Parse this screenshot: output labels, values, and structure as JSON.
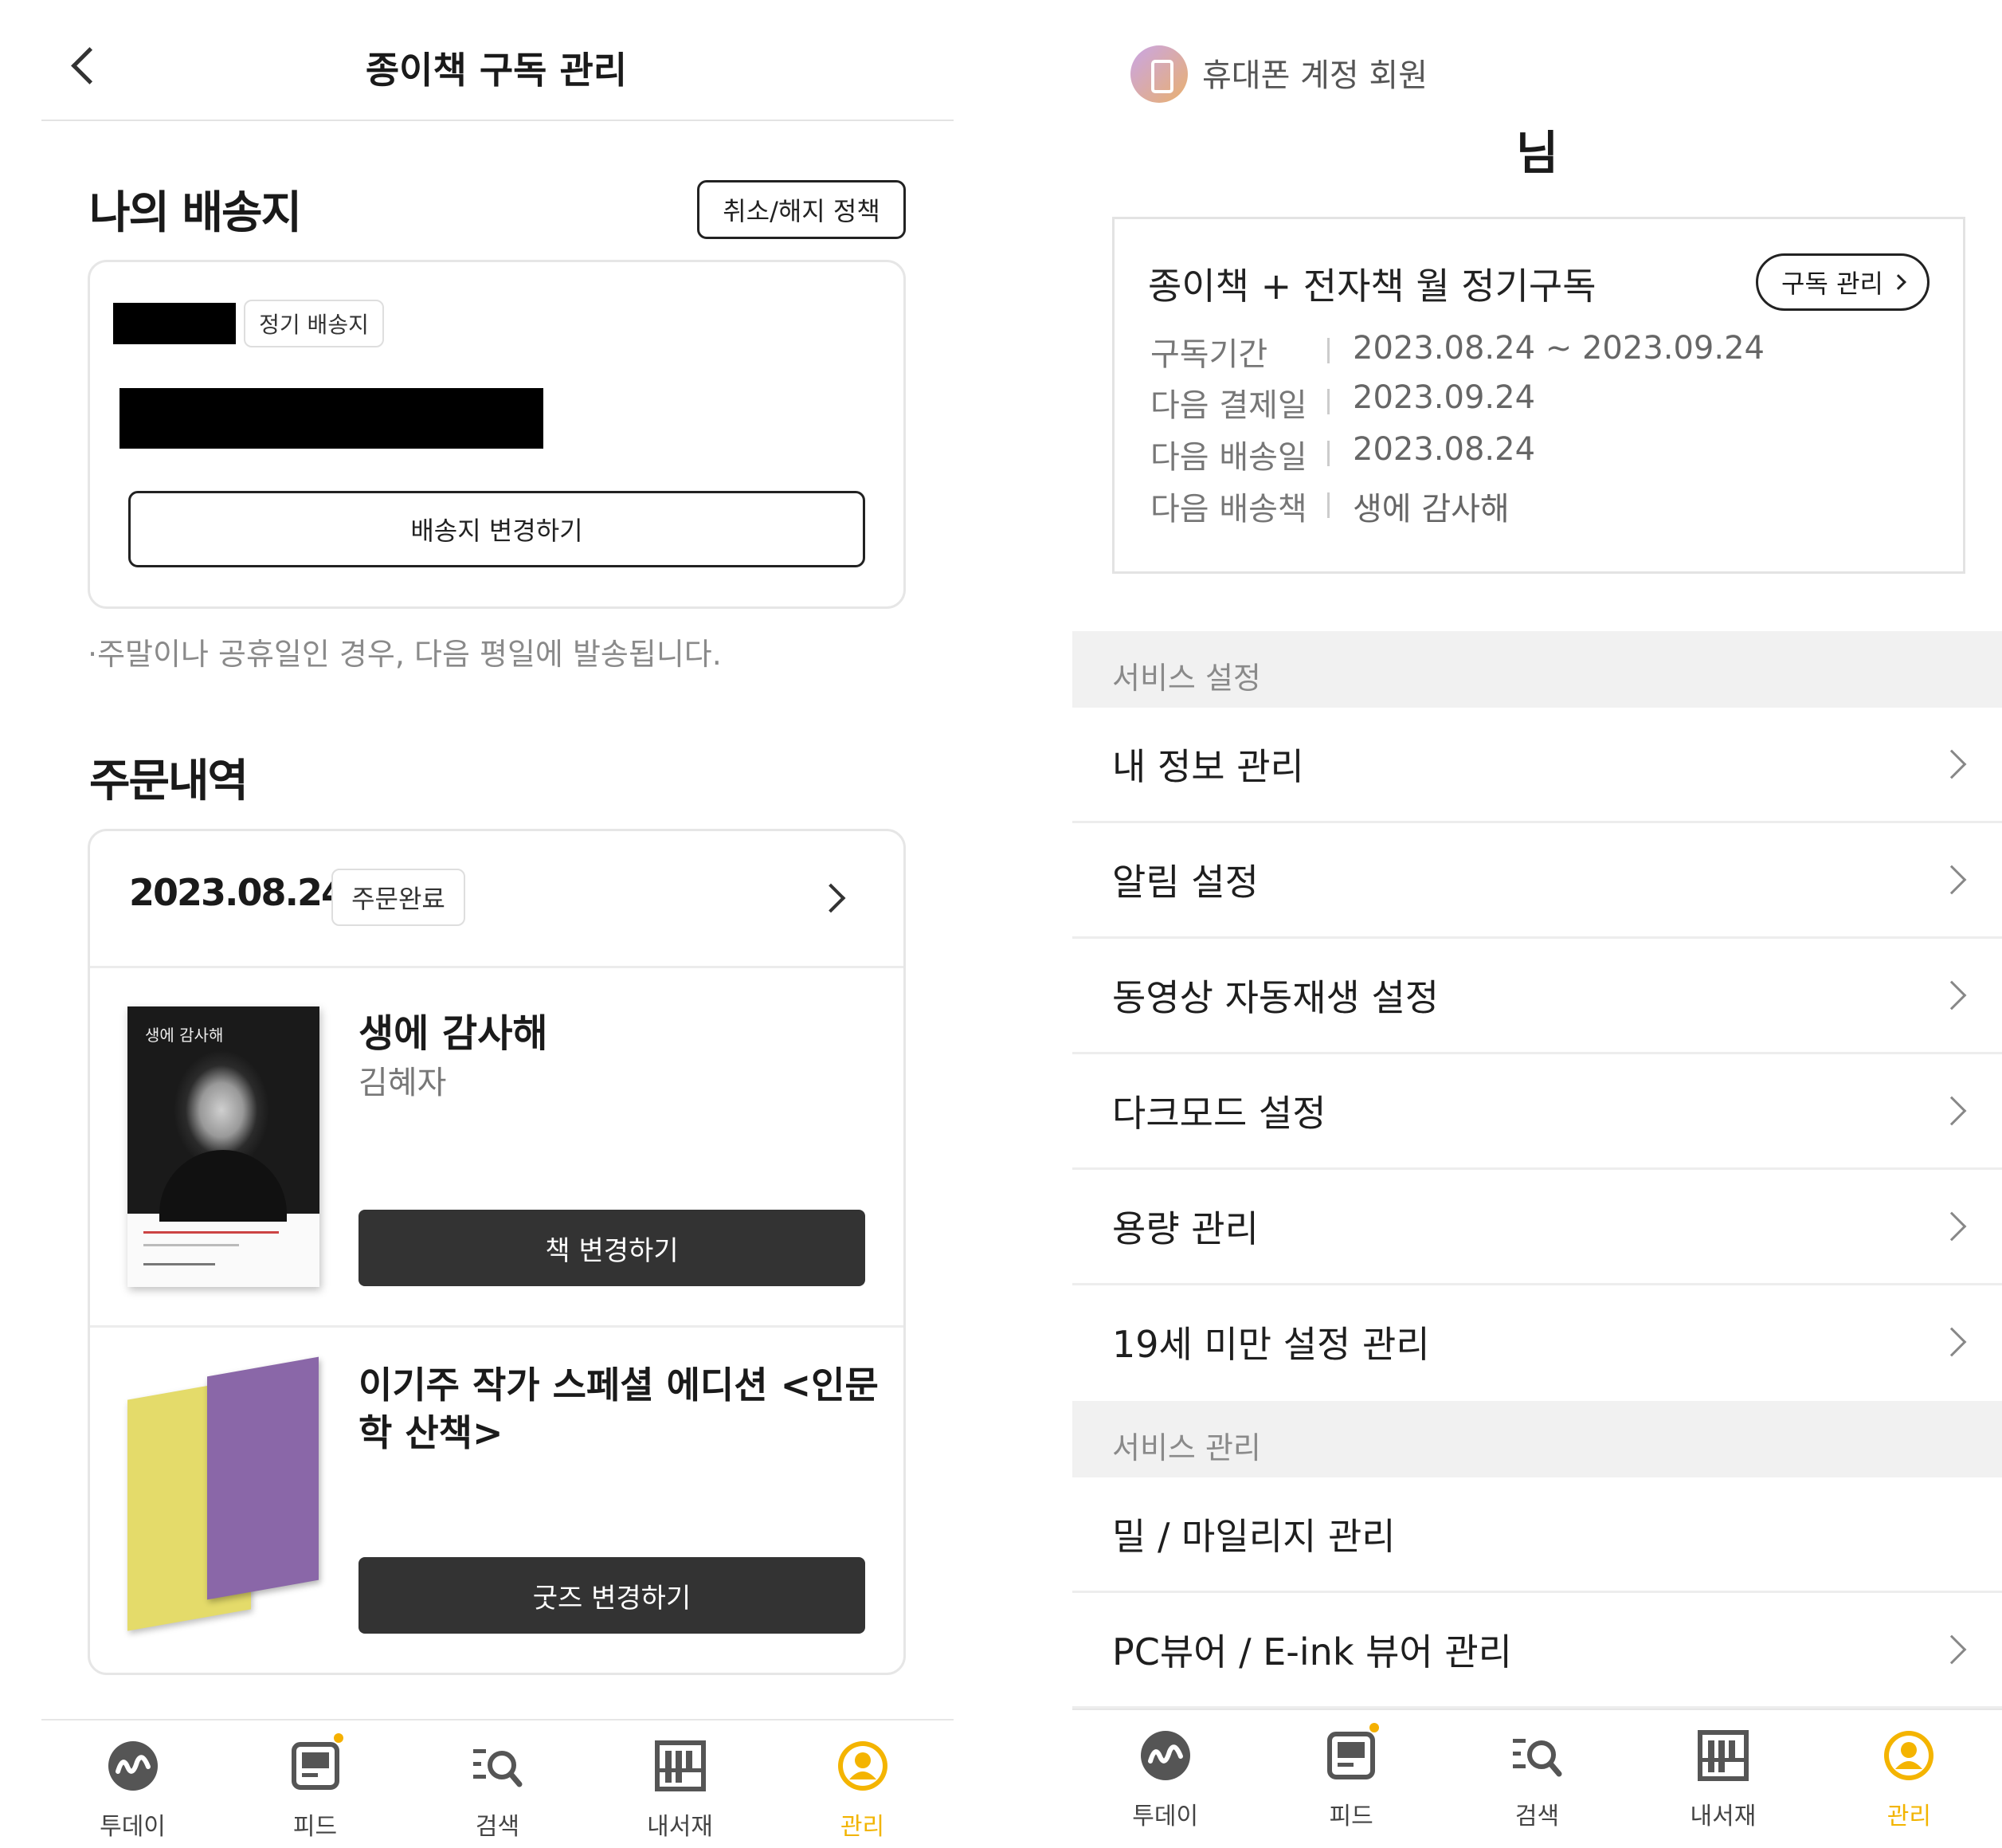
{
  "left": {
    "header": {
      "title": "종이책 구독 관리"
    },
    "shipping": {
      "title": "나의 배송지",
      "policy_button": "취소/해지 정책",
      "tag": "정기 배송지",
      "change_button": "배송지 변경하기",
      "notice": "·주말이나 공휴일인 경우, 다음 평일에 발송됩니다."
    },
    "orders": {
      "title": "주문내역",
      "date": "2023.08.24",
      "status": "주문완료",
      "items": [
        {
          "title": "생에 감사해",
          "author": "김혜자",
          "button": "책 변경하기",
          "cover_title": "생에 감사해"
        },
        {
          "title": "이기주 작가 스페셜 에디션 <인문학 산책>",
          "title_line1": "이기주 작가 스페셜 에디션 <인문",
          "title_line2": "학 산책>",
          "button": "굿즈 변경하기"
        }
      ]
    },
    "tabbar": {
      "tabs": [
        {
          "label": "투데이",
          "icon": "today-icon"
        },
        {
          "label": "피드",
          "icon": "feed-icon"
        },
        {
          "label": "검색",
          "icon": "search-icon"
        },
        {
          "label": "내서재",
          "icon": "library-icon"
        },
        {
          "label": "관리",
          "icon": "profile-icon"
        }
      ],
      "active": "관리",
      "accent_color": "#f2b400"
    }
  },
  "right": {
    "account": {
      "type": "휴대폰 계정 회원",
      "honorific": "님"
    },
    "subscription": {
      "title": "종이책 + 전자책 월 정기구독",
      "manage_button": "구독 관리",
      "rows": [
        {
          "key": "구독기간",
          "value": "2023.08.24 ~ 2023.09.24"
        },
        {
          "key": "다음 결제일",
          "value": "2023.09.24"
        },
        {
          "key": "다음 배송일",
          "value": "2023.08.24"
        },
        {
          "key": "다음 배송책",
          "value": "생에 감사해"
        }
      ]
    },
    "service_settings": {
      "title": "서비스 설정",
      "items": [
        "내 정보 관리",
        "알림 설정",
        "동영상 자동재생 설정",
        "다크모드 설정",
        "용량 관리",
        "19세 미만 설정 관리"
      ]
    },
    "service_management": {
      "title": "서비스 관리",
      "items": [
        "밀 / 마일리지 관리",
        "PC뷰어 / E-ink 뷰어 관리"
      ]
    },
    "tabbar": {
      "tabs": [
        {
          "label": "투데이",
          "icon": "today-icon"
        },
        {
          "label": "피드",
          "icon": "feed-icon"
        },
        {
          "label": "검색",
          "icon": "search-icon"
        },
        {
          "label": "내서재",
          "icon": "library-icon"
        },
        {
          "label": "관리",
          "icon": "profile-icon"
        }
      ],
      "active": "관리"
    }
  }
}
